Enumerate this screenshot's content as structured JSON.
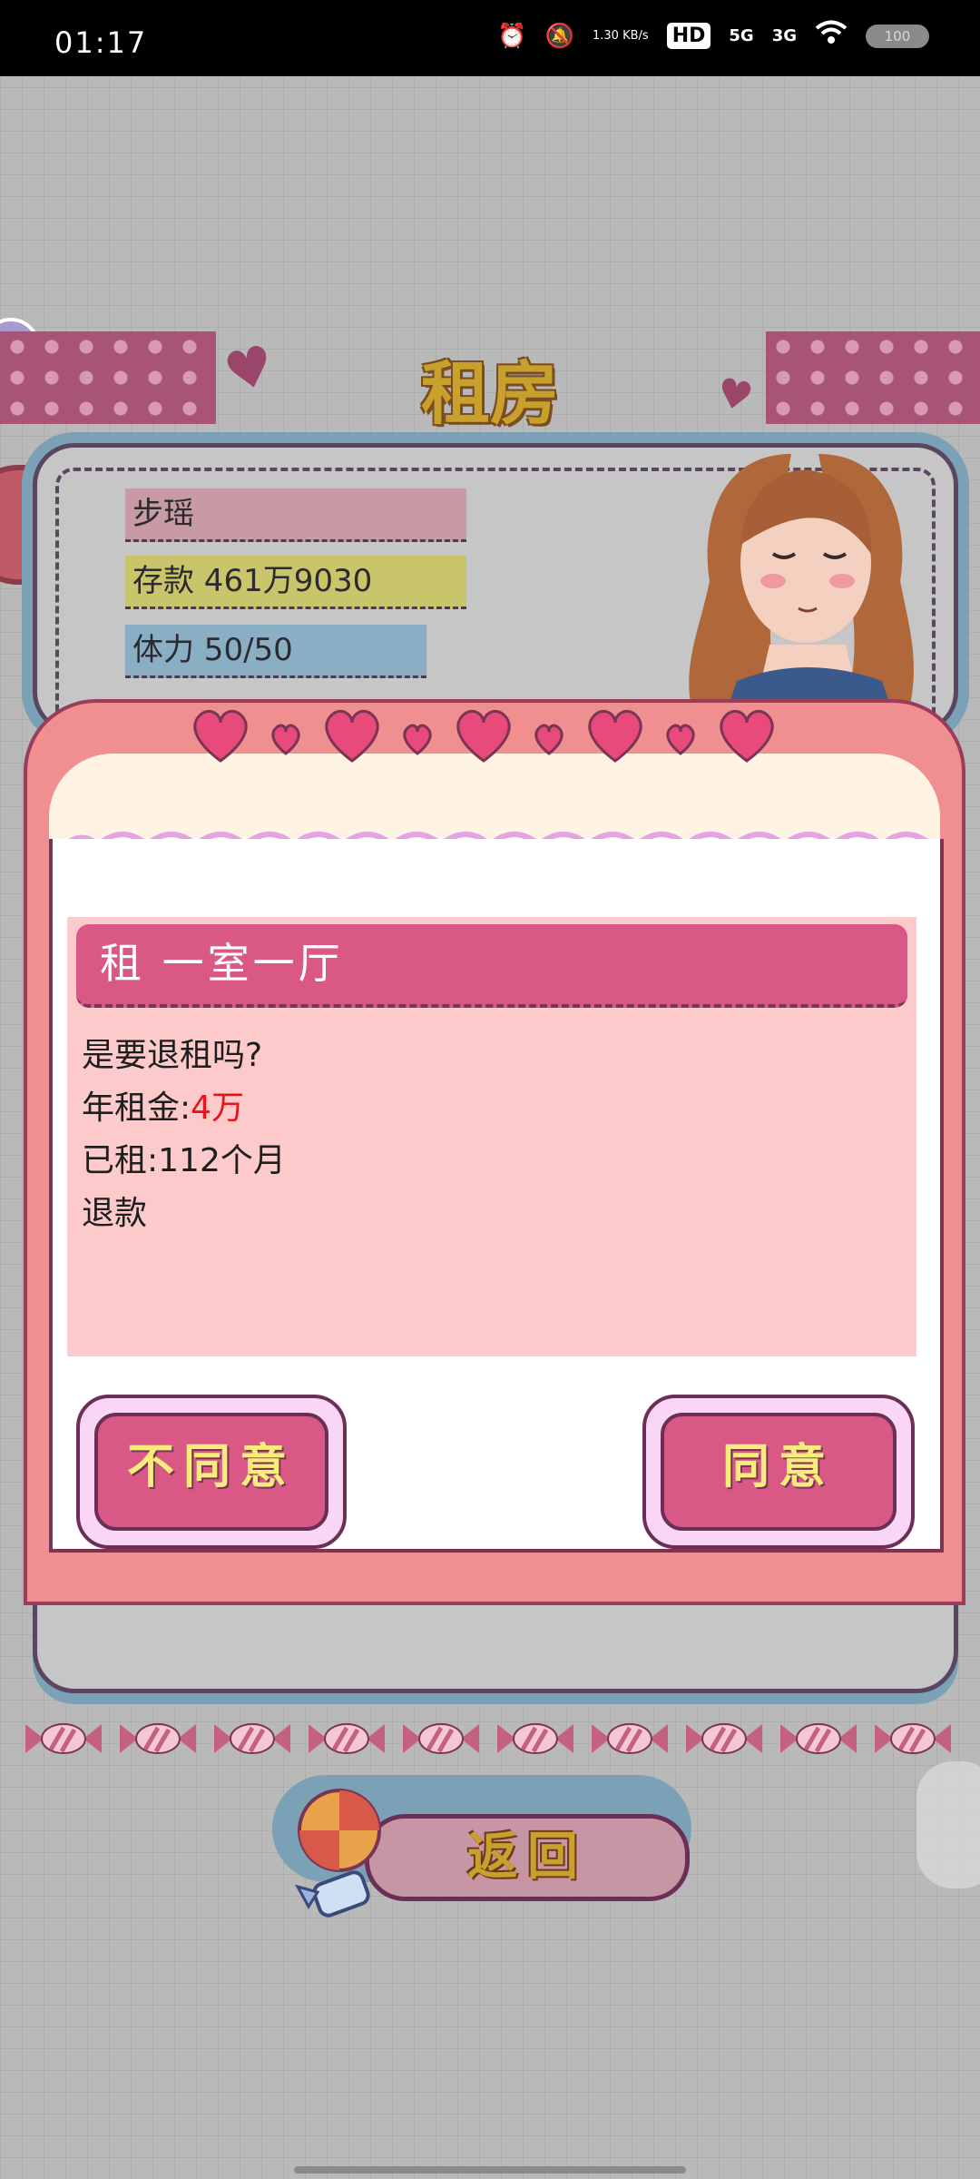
{
  "status_bar": {
    "time": "01:17",
    "net_speed": "1.30 KB/s",
    "hd_badge": "HD",
    "signal1": "5G",
    "signal2": "3G",
    "battery": "100"
  },
  "screen": {
    "title": "租房",
    "profile": {
      "name": "步瑶",
      "savings": "存款 461万9030",
      "stamina": "体力 50/50"
    },
    "dialog": {
      "header": "租 一室一厅",
      "line1": "是要退租吗?",
      "rent_label": "年租金:",
      "rent_value": "4万",
      "rented": "已租:112个月",
      "refund": "退款",
      "disagree_label": "不同意",
      "agree_label": "同意"
    },
    "back_label": "返回"
  },
  "colors": {
    "accent_pink": "#d95886",
    "title_gold": "#c8a02c",
    "highlight_red": "#e8141e"
  }
}
